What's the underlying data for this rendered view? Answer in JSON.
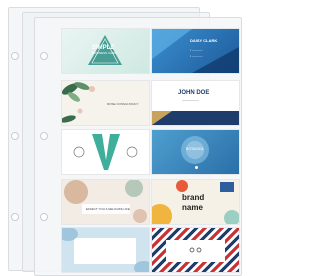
{
  "cards": {
    "simple": {
      "title": "SIMPLE",
      "subtitle": "BUSINESS CARD"
    },
    "clark": {
      "name": "DAISY CLARK"
    },
    "floral": {
      "name": "ROSE CONSULTANCY"
    },
    "doe": {
      "name": "JOHN DOE"
    },
    "botan": {
      "name": "BOTANICA"
    },
    "wander": {
      "script": "Wander"
    },
    "affair": {
      "tagline": "EFFECT YOU A DELICATE LIFE"
    },
    "brand": {
      "line1": "brand",
      "line2": "name"
    }
  },
  "colors": {
    "teal": "#2e8f86",
    "navy": "#1e3d6b",
    "gold": "#c9a35b",
    "barber_red": "#c83232"
  }
}
